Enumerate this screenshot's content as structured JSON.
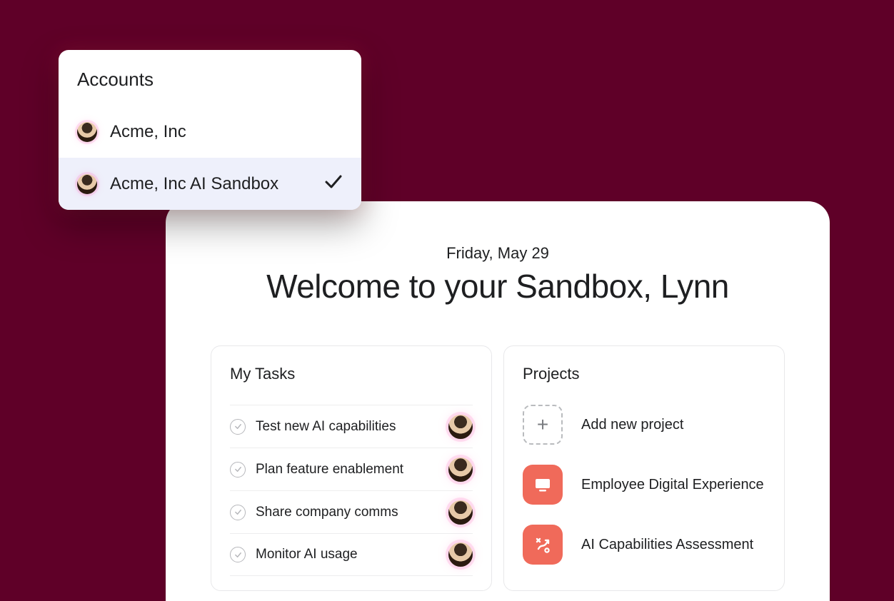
{
  "accounts": {
    "title": "Accounts",
    "items": [
      {
        "label": "Acme, Inc",
        "selected": false
      },
      {
        "label": "Acme, Inc AI Sandbox",
        "selected": true
      }
    ]
  },
  "dashboard": {
    "date": "Friday, May 29",
    "welcome": "Welcome to your Sandbox, Lynn"
  },
  "tasks": {
    "title": "My Tasks",
    "items": [
      {
        "label": "Test new AI capabilities"
      },
      {
        "label": "Plan feature enablement"
      },
      {
        "label": "Share company comms"
      },
      {
        "label": "Monitor AI usage"
      }
    ]
  },
  "projects": {
    "title": "Projects",
    "add_label": "Add new project",
    "items": [
      {
        "label": "Employee Digital Experience",
        "icon": "monitor"
      },
      {
        "label": "AI Capabilities Assessment",
        "icon": "strategy"
      }
    ]
  }
}
